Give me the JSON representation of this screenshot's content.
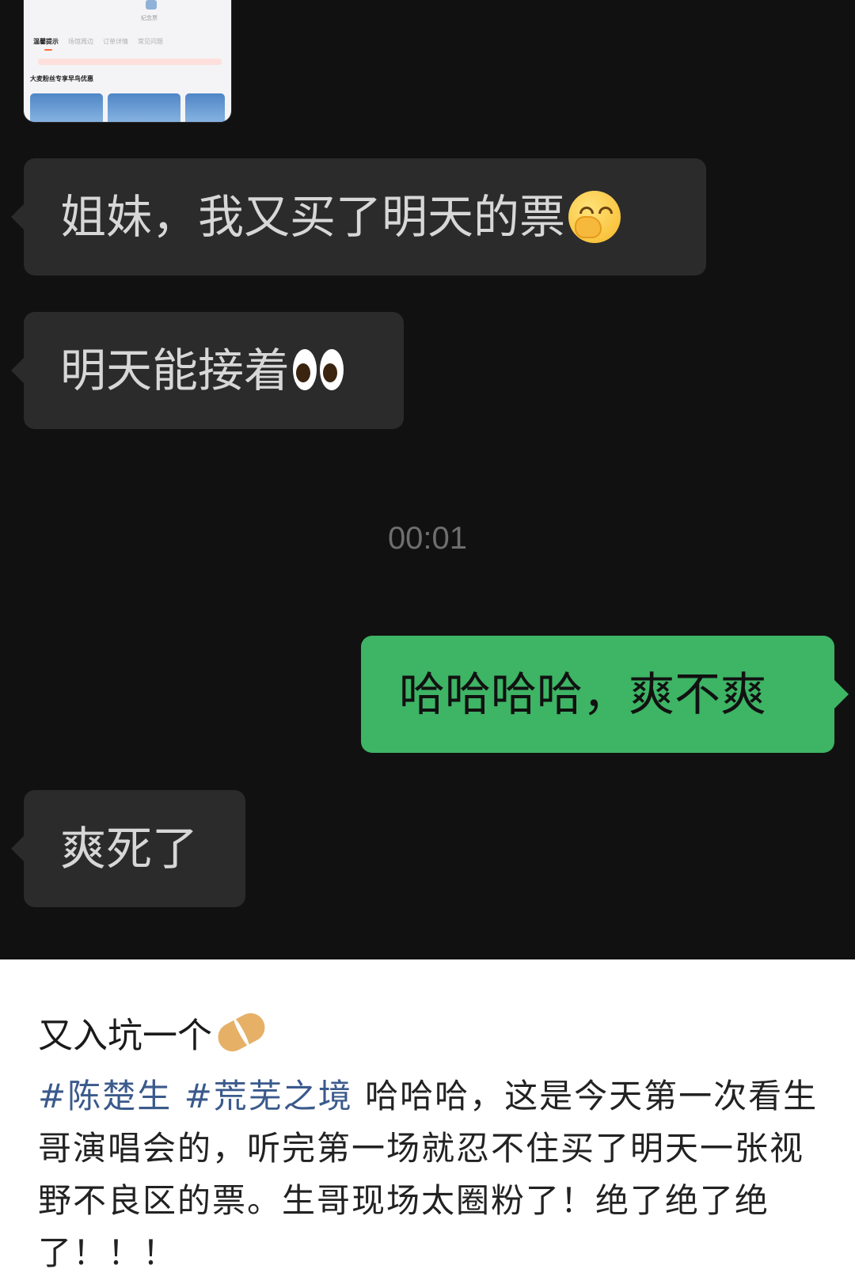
{
  "chat": {
    "thumbnail": {
      "caption": "纪念票",
      "tabs": [
        "温馨提示",
        "场馆周边",
        "订单详情",
        "常见问题"
      ],
      "promo": "大麦粉丝专享早鸟优惠"
    },
    "messages": [
      {
        "side": "incoming",
        "text": "姐妹，我又买了明天的票",
        "emoji": "hand-over-mouth"
      },
      {
        "side": "incoming",
        "text": "明天能接着",
        "emoji": "eyes"
      },
      {
        "side": "outgoing",
        "text": "哈哈哈哈，爽不爽"
      },
      {
        "side": "incoming",
        "text": "爽死了"
      }
    ],
    "timestamp": "00:01"
  },
  "post": {
    "title": "又入坑一个",
    "title_emoji": "peanut",
    "tags": [
      "#陈楚生",
      "#荒芜之境"
    ],
    "body": "哈哈哈，这是今天第一次看生哥演唱会的，听完第一场就忍不住买了明天一张视野不良区的票。生哥现场太圈粉了！绝了绝了绝了！！！"
  },
  "colors": {
    "chat_background": "#111111",
    "incoming_bubble": "#2b2b2b",
    "outgoing_bubble": "#3eb465",
    "hashtag": "#3b5a8c"
  }
}
